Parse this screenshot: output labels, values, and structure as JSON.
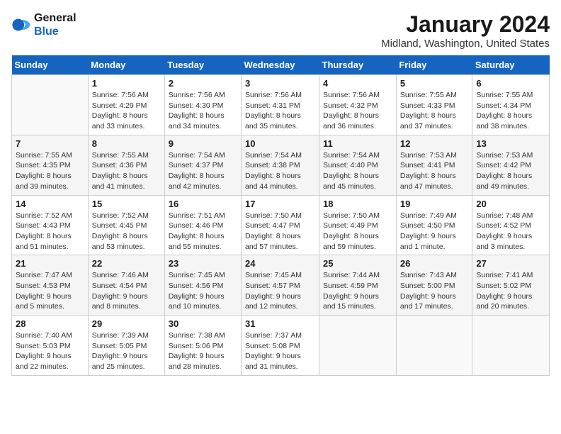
{
  "app": {
    "name": "GeneralBlue",
    "logo_text_line1": "General",
    "logo_text_line2": "Blue"
  },
  "calendar": {
    "title": "January 2024",
    "subtitle": "Midland, Washington, United States",
    "weekdays": [
      "Sunday",
      "Monday",
      "Tuesday",
      "Wednesday",
      "Thursday",
      "Friday",
      "Saturday"
    ],
    "weeks": [
      [
        {
          "day": "",
          "info": ""
        },
        {
          "day": "1",
          "info": "Sunrise: 7:56 AM\nSunset: 4:29 PM\nDaylight: 8 hours\nand 33 minutes."
        },
        {
          "day": "2",
          "info": "Sunrise: 7:56 AM\nSunset: 4:30 PM\nDaylight: 8 hours\nand 34 minutes."
        },
        {
          "day": "3",
          "info": "Sunrise: 7:56 AM\nSunset: 4:31 PM\nDaylight: 8 hours\nand 35 minutes."
        },
        {
          "day": "4",
          "info": "Sunrise: 7:56 AM\nSunset: 4:32 PM\nDaylight: 8 hours\nand 36 minutes."
        },
        {
          "day": "5",
          "info": "Sunrise: 7:55 AM\nSunset: 4:33 PM\nDaylight: 8 hours\nand 37 minutes."
        },
        {
          "day": "6",
          "info": "Sunrise: 7:55 AM\nSunset: 4:34 PM\nDaylight: 8 hours\nand 38 minutes."
        }
      ],
      [
        {
          "day": "7",
          "info": "Sunrise: 7:55 AM\nSunset: 4:35 PM\nDaylight: 8 hours\nand 39 minutes."
        },
        {
          "day": "8",
          "info": "Sunrise: 7:55 AM\nSunset: 4:36 PM\nDaylight: 8 hours\nand 41 minutes."
        },
        {
          "day": "9",
          "info": "Sunrise: 7:54 AM\nSunset: 4:37 PM\nDaylight: 8 hours\nand 42 minutes."
        },
        {
          "day": "10",
          "info": "Sunrise: 7:54 AM\nSunset: 4:38 PM\nDaylight: 8 hours\nand 44 minutes."
        },
        {
          "day": "11",
          "info": "Sunrise: 7:54 AM\nSunset: 4:40 PM\nDaylight: 8 hours\nand 45 minutes."
        },
        {
          "day": "12",
          "info": "Sunrise: 7:53 AM\nSunset: 4:41 PM\nDaylight: 8 hours\nand 47 minutes."
        },
        {
          "day": "13",
          "info": "Sunrise: 7:53 AM\nSunset: 4:42 PM\nDaylight: 8 hours\nand 49 minutes."
        }
      ],
      [
        {
          "day": "14",
          "info": "Sunrise: 7:52 AM\nSunset: 4:43 PM\nDaylight: 8 hours\nand 51 minutes."
        },
        {
          "day": "15",
          "info": "Sunrise: 7:52 AM\nSunset: 4:45 PM\nDaylight: 8 hours\nand 53 minutes."
        },
        {
          "day": "16",
          "info": "Sunrise: 7:51 AM\nSunset: 4:46 PM\nDaylight: 8 hours\nand 55 minutes."
        },
        {
          "day": "17",
          "info": "Sunrise: 7:50 AM\nSunset: 4:47 PM\nDaylight: 8 hours\nand 57 minutes."
        },
        {
          "day": "18",
          "info": "Sunrise: 7:50 AM\nSunset: 4:49 PM\nDaylight: 8 hours\nand 59 minutes."
        },
        {
          "day": "19",
          "info": "Sunrise: 7:49 AM\nSunset: 4:50 PM\nDaylight: 9 hours\nand 1 minute."
        },
        {
          "day": "20",
          "info": "Sunrise: 7:48 AM\nSunset: 4:52 PM\nDaylight: 9 hours\nand 3 minutes."
        }
      ],
      [
        {
          "day": "21",
          "info": "Sunrise: 7:47 AM\nSunset: 4:53 PM\nDaylight: 9 hours\nand 5 minutes."
        },
        {
          "day": "22",
          "info": "Sunrise: 7:46 AM\nSunset: 4:54 PM\nDaylight: 9 hours\nand 8 minutes."
        },
        {
          "day": "23",
          "info": "Sunrise: 7:45 AM\nSunset: 4:56 PM\nDaylight: 9 hours\nand 10 minutes."
        },
        {
          "day": "24",
          "info": "Sunrise: 7:45 AM\nSunset: 4:57 PM\nDaylight: 9 hours\nand 12 minutes."
        },
        {
          "day": "25",
          "info": "Sunrise: 7:44 AM\nSunset: 4:59 PM\nDaylight: 9 hours\nand 15 minutes."
        },
        {
          "day": "26",
          "info": "Sunrise: 7:43 AM\nSunset: 5:00 PM\nDaylight: 9 hours\nand 17 minutes."
        },
        {
          "day": "27",
          "info": "Sunrise: 7:41 AM\nSunset: 5:02 PM\nDaylight: 9 hours\nand 20 minutes."
        }
      ],
      [
        {
          "day": "28",
          "info": "Sunrise: 7:40 AM\nSunset: 5:03 PM\nDaylight: 9 hours\nand 22 minutes."
        },
        {
          "day": "29",
          "info": "Sunrise: 7:39 AM\nSunset: 5:05 PM\nDaylight: 9 hours\nand 25 minutes."
        },
        {
          "day": "30",
          "info": "Sunrise: 7:38 AM\nSunset: 5:06 PM\nDaylight: 9 hours\nand 28 minutes."
        },
        {
          "day": "31",
          "info": "Sunrise: 7:37 AM\nSunset: 5:08 PM\nDaylight: 9 hours\nand 31 minutes."
        },
        {
          "day": "",
          "info": ""
        },
        {
          "day": "",
          "info": ""
        },
        {
          "day": "",
          "info": ""
        }
      ]
    ]
  }
}
